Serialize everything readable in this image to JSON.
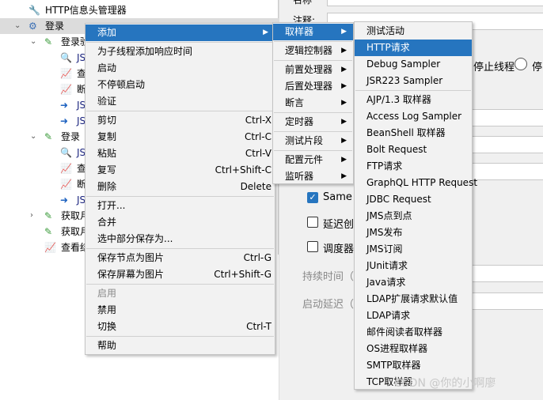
{
  "tree": [
    {
      "label": "HTTP信息头管理器",
      "icon": "wrench-icon",
      "indent": 1,
      "twist": ""
    },
    {
      "label": "登录",
      "icon": "gear-icon",
      "indent": 1,
      "twist": "expanded",
      "selected": true
    },
    {
      "label": "登录验",
      "icon": "dropper-icon",
      "indent": 2,
      "twist": "expanded"
    },
    {
      "label": "JS",
      "icon": "magnifier-icon",
      "indent": 3,
      "twist": ""
    },
    {
      "label": "查",
      "icon": "graph-icon",
      "indent": 3,
      "twist": ""
    },
    {
      "label": "断",
      "icon": "graph-icon",
      "indent": 3,
      "twist": ""
    },
    {
      "label": "JS",
      "icon": "arrow-doc-icon",
      "indent": 3,
      "twist": ""
    },
    {
      "label": "JS",
      "icon": "arrow-doc-icon",
      "indent": 3,
      "twist": ""
    },
    {
      "label": "登录",
      "icon": "dropper-icon",
      "indent": 2,
      "twist": "expanded"
    },
    {
      "label": "JS",
      "icon": "magnifier-icon",
      "indent": 3,
      "twist": ""
    },
    {
      "label": "查",
      "icon": "graph-icon",
      "indent": 3,
      "twist": ""
    },
    {
      "label": "断",
      "icon": "graph-icon",
      "indent": 3,
      "twist": ""
    },
    {
      "label": "JS",
      "icon": "arrow-doc-icon",
      "indent": 3,
      "twist": ""
    },
    {
      "label": "获取月",
      "icon": "dropper-icon",
      "indent": 2,
      "twist": "collapsed"
    },
    {
      "label": "获取月",
      "icon": "dropper-icon",
      "indent": 2,
      "twist": ""
    },
    {
      "label": "查看结",
      "icon": "graph-icon",
      "indent": 2,
      "twist": ""
    }
  ],
  "right": {
    "name_label": "名称",
    "comment_label": "注释:",
    "stop_thread": "停止线程",
    "stop_partial": "停",
    "same_user": "Same u",
    "delay_create": "延迟创",
    "scheduler": "调度器",
    "duration": "持续时间（秒",
    "startup_delay": "启动延迟（秒"
  },
  "menu1": [
    {
      "label": "添加",
      "arrow": true,
      "hl": true
    },
    "sep",
    {
      "label": "为子线程添加响应时间"
    },
    {
      "label": "启动"
    },
    {
      "label": "不停顿启动"
    },
    {
      "label": "验证"
    },
    "sep",
    {
      "label": "剪切",
      "sc": "Ctrl-X"
    },
    {
      "label": "复制",
      "sc": "Ctrl-C"
    },
    {
      "label": "粘贴",
      "sc": "Ctrl-V"
    },
    {
      "label": "复写",
      "sc": "Ctrl+Shift-C"
    },
    {
      "label": "删除",
      "sc": "Delete"
    },
    "sep",
    {
      "label": "打开..."
    },
    {
      "label": "合并"
    },
    {
      "label": "选中部分保存为..."
    },
    "sep",
    {
      "label": "保存节点为图片",
      "sc": "Ctrl-G"
    },
    {
      "label": "保存屏幕为图片",
      "sc": "Ctrl+Shift-G"
    },
    "sep",
    {
      "label": "启用",
      "disabled": true
    },
    {
      "label": "禁用"
    },
    {
      "label": "切换",
      "sc": "Ctrl-T"
    },
    "sep",
    {
      "label": "帮助"
    }
  ],
  "menu2": [
    {
      "label": "取样器",
      "arrow": true,
      "hl": true
    },
    "sep",
    {
      "label": "逻辑控制器",
      "arrow": true
    },
    "sep",
    {
      "label": "前置处理器",
      "arrow": true
    },
    {
      "label": "后置处理器",
      "arrow": true
    },
    {
      "label": "断言",
      "arrow": true
    },
    "sep",
    {
      "label": "定时器",
      "arrow": true
    },
    "sep",
    {
      "label": "测试片段",
      "arrow": true
    },
    "sep",
    {
      "label": "配置元件",
      "arrow": true
    },
    {
      "label": "监听器",
      "arrow": true
    }
  ],
  "menu3": [
    {
      "label": "测试活动"
    },
    {
      "label": "HTTP请求",
      "hl": true
    },
    {
      "label": "Debug Sampler"
    },
    {
      "label": "JSR223 Sampler"
    },
    "sep",
    {
      "label": "AJP/1.3 取样器"
    },
    {
      "label": "Access Log Sampler"
    },
    {
      "label": "BeanShell 取样器"
    },
    {
      "label": "Bolt Request"
    },
    {
      "label": "FTP请求"
    },
    {
      "label": "GraphQL HTTP Request"
    },
    {
      "label": "JDBC Request"
    },
    {
      "label": "JMS点到点"
    },
    {
      "label": "JMS发布"
    },
    {
      "label": "JMS订阅"
    },
    {
      "label": "JUnit请求"
    },
    {
      "label": "Java请求"
    },
    {
      "label": "LDAP扩展请求默认值"
    },
    {
      "label": "LDAP请求"
    },
    {
      "label": "邮件阅读者取样器"
    },
    {
      "label": "OS进程取样器"
    },
    {
      "label": "SMTP取样器"
    },
    {
      "label": "TCP取样器"
    }
  ],
  "watermark": "CSDN @你的小啊廖",
  "colors": {
    "highlight": "#2675bf",
    "selected_row": "#dcdcdc",
    "menu_bg": "#f2f2f2"
  }
}
